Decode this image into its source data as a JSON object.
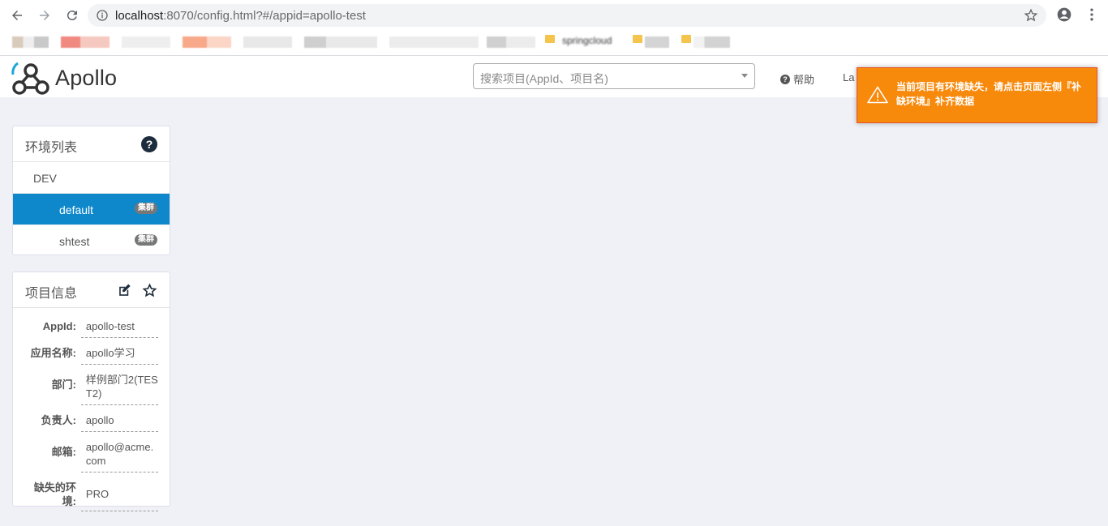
{
  "browser": {
    "url_host": "localhost",
    "url_path": ":8070/config.html?#/appid=apollo-test",
    "bookmark_label": "springcloud"
  },
  "header": {
    "logo_text": "Apollo",
    "search_placeholder": "搜索项目(AppId、项目名)",
    "help_label": "帮助",
    "lang_label": "La"
  },
  "env_panel": {
    "title": "环境列表",
    "env_name": "DEV",
    "clusters": [
      {
        "name": "default",
        "badge": "集群",
        "active": true
      },
      {
        "name": "shtest",
        "badge": "集群",
        "active": false
      }
    ]
  },
  "info_panel": {
    "title": "项目信息",
    "rows": [
      {
        "key": "AppId:",
        "value": "apollo-test"
      },
      {
        "key": "应用名称:",
        "value": "apollo学习"
      },
      {
        "key": "部门:",
        "value": "样例部门2(TEST2)"
      },
      {
        "key": "负责人:",
        "value": "apollo"
      },
      {
        "key": "邮箱:",
        "value": "apollo@acme.com"
      },
      {
        "key": "缺失的环境:",
        "value": "PRO"
      }
    ]
  },
  "toast": {
    "message": "当前项目有环境缺失，请点击页面左侧『补缺环境』补齐数据",
    "color": "#f7890b"
  },
  "colors": {
    "accent": "#0f88cb",
    "background": "#f0f1f6"
  }
}
